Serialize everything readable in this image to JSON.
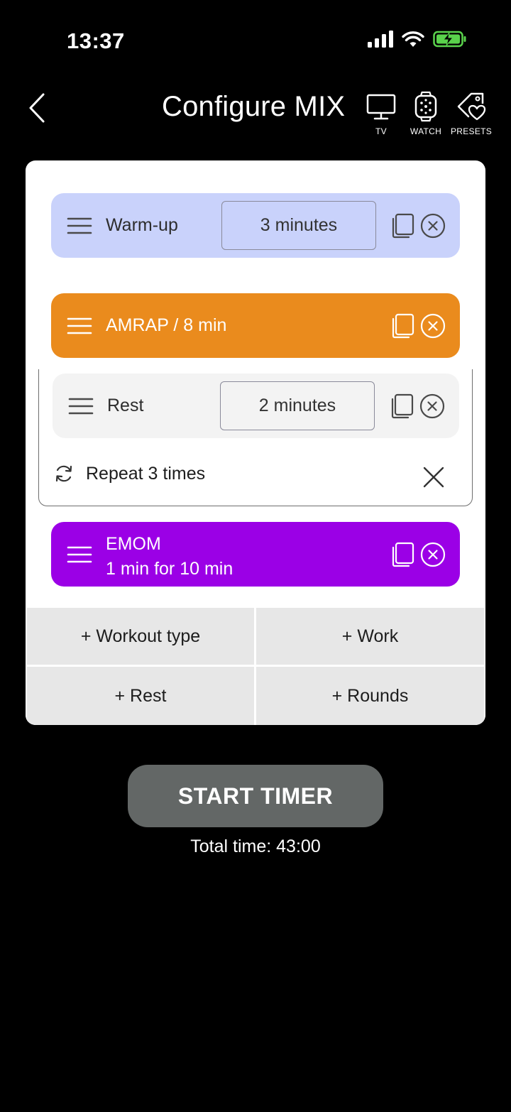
{
  "status": {
    "time": "13:37"
  },
  "header": {
    "title": "Configure MIX",
    "tv_label": "TV",
    "watch_label": "WATCH",
    "presets_label": "PRESETS"
  },
  "blocks": {
    "warmup": {
      "label": "Warm-up",
      "duration": "3 minutes",
      "color": "#c9d2fb"
    },
    "amrap": {
      "label": "AMRAP / 8 min",
      "color": "#ea8b1d"
    },
    "rest": {
      "label": "Rest",
      "duration": "2 minutes",
      "color": "#f3f3f3"
    },
    "repeat": {
      "label": "Repeat 3 times"
    },
    "emom": {
      "line1": "EMOM",
      "line2": "1 min for 10 min",
      "color": "#9b00e6"
    }
  },
  "add": {
    "workout_type": "+ Workout type",
    "work": "+ Work",
    "rest": "+ Rest",
    "rounds": "+ Rounds"
  },
  "footer": {
    "start_label": "START TIMER",
    "total_time": "Total time: 43:00"
  }
}
